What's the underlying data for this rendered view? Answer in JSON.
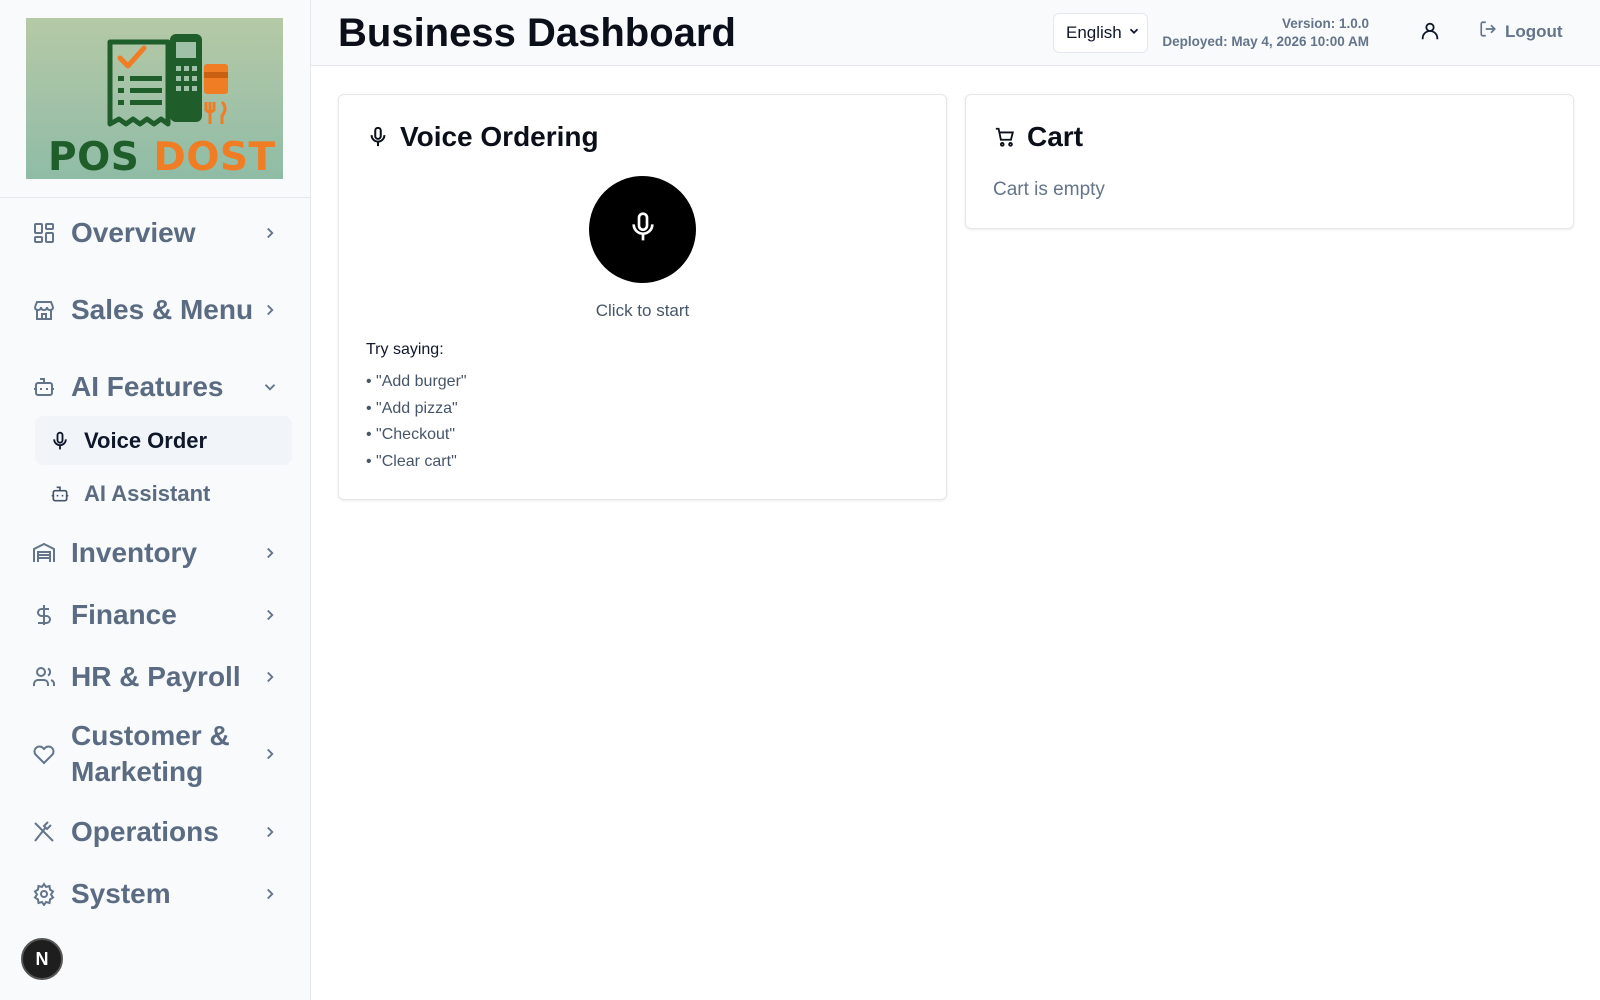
{
  "logo": {
    "text_part1": "POS",
    "text_part2": "DOST"
  },
  "sidebar": {
    "items": [
      {
        "label": "Overview",
        "icon": "layout-grid-icon"
      },
      {
        "label": "Sales & Menu",
        "icon": "store-icon"
      },
      {
        "label": "AI Features",
        "icon": "bot-icon",
        "expanded": true,
        "children": [
          {
            "label": "Voice Order",
            "icon": "mic-icon",
            "active": true
          },
          {
            "label": "AI Assistant",
            "icon": "bot-icon"
          }
        ]
      },
      {
        "label": "Inventory",
        "icon": "warehouse-icon"
      },
      {
        "label": "Finance",
        "icon": "dollar-icon"
      },
      {
        "label": "HR & Payroll",
        "icon": "users-icon"
      },
      {
        "label": "Customer & Marketing",
        "icon": "heart-icon"
      },
      {
        "label": "Operations",
        "icon": "utensils-crossed-icon"
      },
      {
        "label": "System",
        "icon": "settings-icon"
      }
    ]
  },
  "badge": {
    "letter": "N"
  },
  "header": {
    "title": "Business Dashboard",
    "language": "English",
    "version": "Version: 1.0.0",
    "deployed": "Deployed: May 4, 2026 10:00 AM",
    "logout_label": "Logout"
  },
  "voice_card": {
    "title": "Voice Ordering",
    "status": "Click to start",
    "try_title": "Try saying:",
    "examples": [
      "\"Add burger\"",
      "\"Add pizza\"",
      "\"Checkout\"",
      "\"Clear cart\""
    ]
  },
  "cart_card": {
    "title": "Cart",
    "empty_text": "Cart is empty"
  },
  "colors": {
    "accent_orange": "#f07c23",
    "logo_green": "#1f5d2a",
    "mic_button": "#000000"
  }
}
